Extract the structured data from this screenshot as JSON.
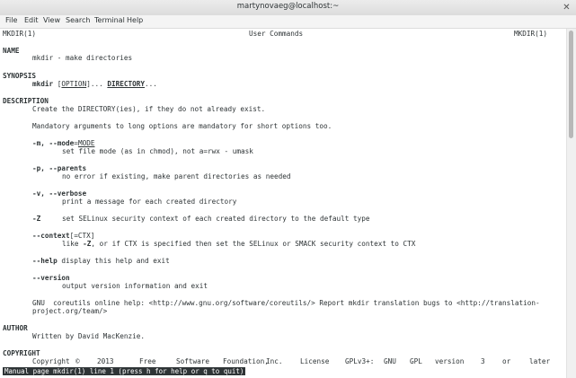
{
  "window": {
    "title": "martynovaeg@localhost:~",
    "close_glyph": "✕"
  },
  "menu": [
    "File",
    "Edit",
    "View",
    "Search",
    "Terminal",
    "Help"
  ],
  "man": {
    "header": {
      "left": "MKDIR(1)",
      "center": "User Commands",
      "right": "MKDIR(1)"
    },
    "sections": {
      "name": "NAME",
      "synopsis": "SYNOPSIS",
      "description": "DESCRIPTION",
      "author": "AUTHOR",
      "copyright": "COPYRIGHT"
    },
    "name_line": "mkdir - make directories",
    "synopsis": {
      "cmd": "mkdir",
      "option": "OPTION",
      "directory": "DIRECTORY",
      "dots": "..."
    },
    "desc1": "Create the DIRECTORY(ies), if they do not already exist.",
    "desc2": "Mandatory arguments to long options are mandatory for short options too.",
    "opt_m": {
      "flag": "-m, --mode",
      "eq": "=",
      "arg": "MODE",
      "text": "set file mode (as in chmod), not a=rwx - umask"
    },
    "opt_p": {
      "flag": "-p, --parents",
      "text": "no error if existing, make parent directories as needed"
    },
    "opt_v": {
      "flag": "-v, --verbose",
      "text": "print a message for each created directory"
    },
    "opt_Z": {
      "flag": "-Z",
      "text": "set SELinux security context of each created directory to the default type"
    },
    "opt_context": {
      "flag": "--context",
      "arg": "[=CTX]",
      "text_a": "like ",
      "text_flag": "-Z",
      "text_b": ", or if CTX is specified then set the SELinux or SMACK security context to CTX"
    },
    "opt_help": {
      "flag": "--help",
      "text": " display this help and exit"
    },
    "opt_version": {
      "flag": "--version",
      "text": "output version information and exit"
    },
    "gnu1": "GNU  coreutils online help: <http://www.gnu.org/software/coreutils/> Report mkdir translation bugs to <http://translation-",
    "gnu2": "project.org/team/>",
    "author_line": "Written by David MacKenzie.",
    "copyright_words": [
      "Copyright",
      "©",
      "2013",
      "Free",
      "Software",
      "Foundation,",
      "Inc.",
      "License",
      "GPLv3+:",
      "GNU",
      "GPL",
      "version",
      "3",
      "or",
      "later"
    ]
  },
  "status": "Manual page mkdir(1) line 1 (press h for help or q to quit)"
}
